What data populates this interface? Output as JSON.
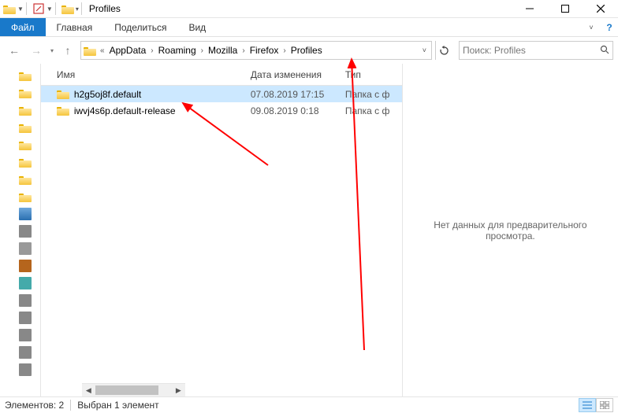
{
  "titlebar": {
    "title": "Profiles"
  },
  "ribbon": {
    "file": "Файл",
    "tabs": [
      "Главная",
      "Поделиться",
      "Вид"
    ]
  },
  "breadcrumb": {
    "items": [
      "AppData",
      "Roaming",
      "Mozilla",
      "Firefox",
      "Profiles"
    ]
  },
  "search": {
    "placeholder": "Поиск: Profiles"
  },
  "columns": {
    "name": "Имя",
    "date": "Дата изменения",
    "type": "Тип"
  },
  "rows": [
    {
      "name": "h2g5oj8f.default",
      "date": "07.08.2019 17:15",
      "type": "Папка с ф",
      "selected": true
    },
    {
      "name": "iwvj4s6p.default-release",
      "date": "09.08.2019 0:18",
      "type": "Папка с ф",
      "selected": false
    }
  ],
  "preview": {
    "empty": "Нет данных для предварительного просмотра."
  },
  "status": {
    "count": "Элементов: 2",
    "selection": "Выбран 1 элемент"
  }
}
